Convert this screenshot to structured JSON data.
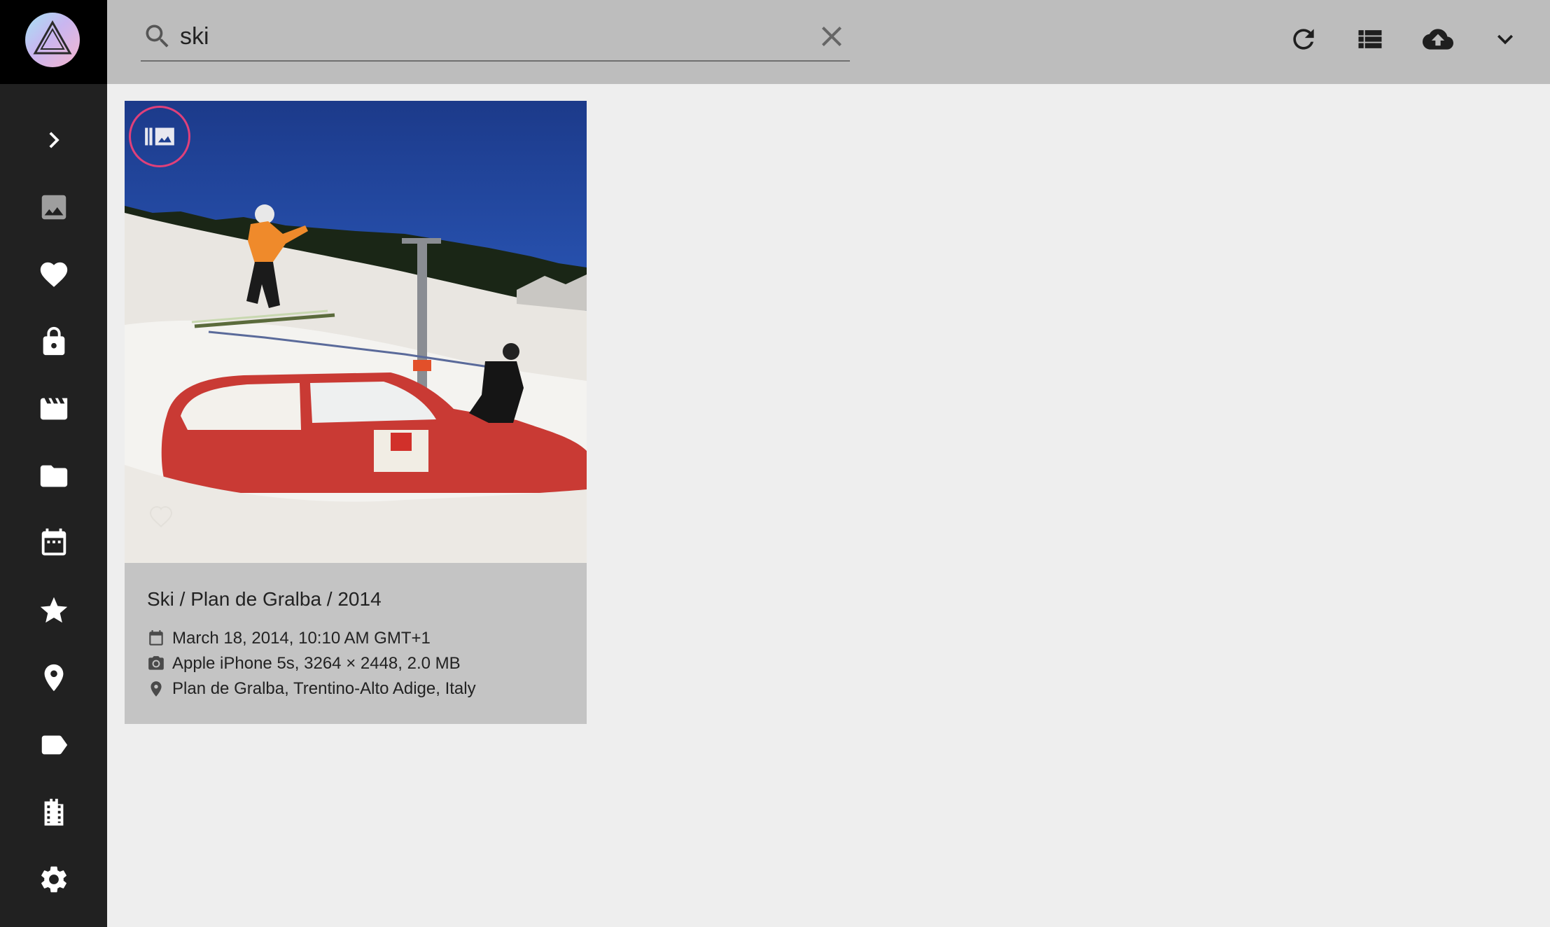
{
  "search": {
    "query": "ski",
    "placeholder": "Search"
  },
  "sidebar": {
    "items": [
      {
        "icon": "chevron-right-icon"
      },
      {
        "icon": "image-icon"
      },
      {
        "icon": "heart-icon"
      },
      {
        "icon": "lock-icon"
      },
      {
        "icon": "movie-icon"
      },
      {
        "icon": "folder-icon"
      },
      {
        "icon": "calendar-icon"
      },
      {
        "icon": "star-icon"
      },
      {
        "icon": "place-icon"
      },
      {
        "icon": "label-icon"
      },
      {
        "icon": "film-folder-icon"
      },
      {
        "icon": "gear-icon"
      }
    ]
  },
  "toolbar": {
    "buttons": [
      "refresh-icon",
      "list-view-icon",
      "cloud-upload-icon",
      "chevron-down-icon"
    ]
  },
  "card": {
    "title": "Ski / Plan de Gralba / 2014",
    "date": "March 18, 2014, 10:10 AM GMT+1",
    "camera": "Apple iPhone 5s, 3264 × 2448, 2.0 MB",
    "location": "Plan de Gralba, Trentino-Alto Adige, Italy"
  },
  "colors": {
    "sidebar_bg": "#212121",
    "toolbar_bg": "#bdbdbd",
    "page_bg": "#eeeeee",
    "card_bg": "#c4c4c4",
    "stack_badge_ring": "#e0407a"
  }
}
